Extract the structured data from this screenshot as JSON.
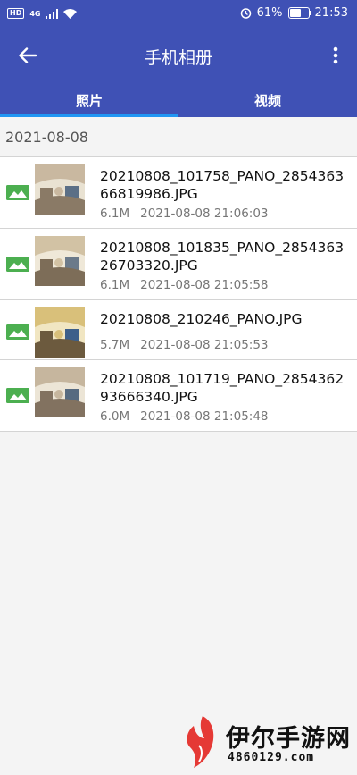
{
  "status_bar": {
    "hd_badge": "HD",
    "signal_badge": "4G",
    "battery_percent_text": "61%",
    "battery_level": 0.61,
    "time": "21:53"
  },
  "toolbar": {
    "title": "手机相册"
  },
  "tabs": [
    {
      "label": "照片",
      "active": true
    },
    {
      "label": "视频",
      "active": false
    }
  ],
  "section_date": "2021-08-08",
  "files": [
    {
      "name": "20210808_101758_PANO_285436366819986.JPG",
      "size": "6.1M",
      "datetime": "2021-08-08 21:06:03"
    },
    {
      "name": "20210808_101835_PANO_285436326703320.JPG",
      "size": "6.1M",
      "datetime": "2021-08-08 21:05:58"
    },
    {
      "name": "20210808_210246_PANO.JPG",
      "size": "5.7M",
      "datetime": "2021-08-08 21:05:53"
    },
    {
      "name": "20210808_101719_PANO_285436293666340.JPG",
      "size": "6.0M",
      "datetime": "2021-08-08 21:05:48"
    }
  ],
  "watermark": {
    "name": "伊尔手游网",
    "url": "4860129.com"
  },
  "colors": {
    "header": "#3f51b5",
    "tab_indicator": "#2196f3",
    "image_icon": "#4caf50",
    "watermark_logo": "#e53935"
  }
}
